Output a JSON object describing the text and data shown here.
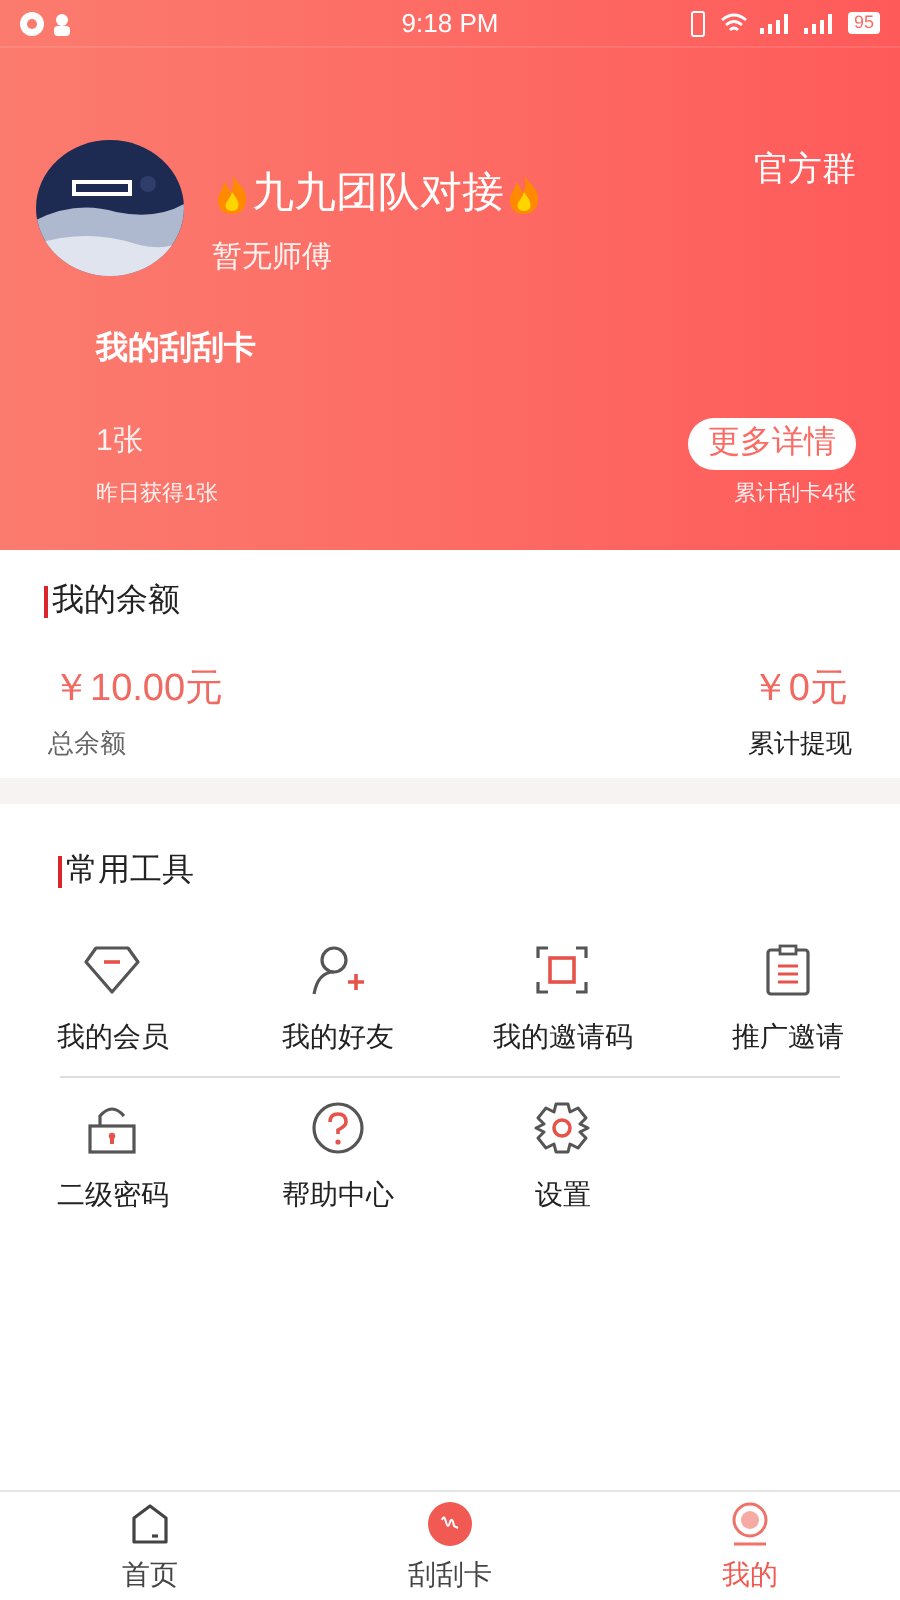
{
  "status_bar": {
    "time": "9:18 PM",
    "battery": "95"
  },
  "profile": {
    "name": "九九团队对接",
    "master": "暂无师傅",
    "group_link": "官方群"
  },
  "card": {
    "title": "我的刮刮卡",
    "count": "1张",
    "yesterday": "昨日获得1张",
    "more_button": "更多详情",
    "total": "累计刮卡4张"
  },
  "balance": {
    "title": "我的余额",
    "amount": "￥10.00元",
    "amount_label": "总余额",
    "withdrawn": "￥0元",
    "withdrawn_label": "累计提现"
  },
  "tools": {
    "title": "常用工具",
    "items": [
      {
        "kind": "diamond",
        "label": "我的会员"
      },
      {
        "kind": "friend",
        "label": "我的好友"
      },
      {
        "kind": "scan",
        "label": "我的邀请码"
      },
      {
        "kind": "clipboard",
        "label": "推广邀请"
      },
      {
        "kind": "lock",
        "label": "二级密码"
      },
      {
        "kind": "help",
        "label": "帮助中心"
      },
      {
        "kind": "gear",
        "label": "设置"
      }
    ]
  },
  "tab_bar": [
    {
      "kind": "home",
      "label": "首页",
      "selected": false
    },
    {
      "kind": "card",
      "label": "刮刮卡",
      "selected": false
    },
    {
      "kind": "me",
      "label": "我的",
      "selected": true
    }
  ]
}
